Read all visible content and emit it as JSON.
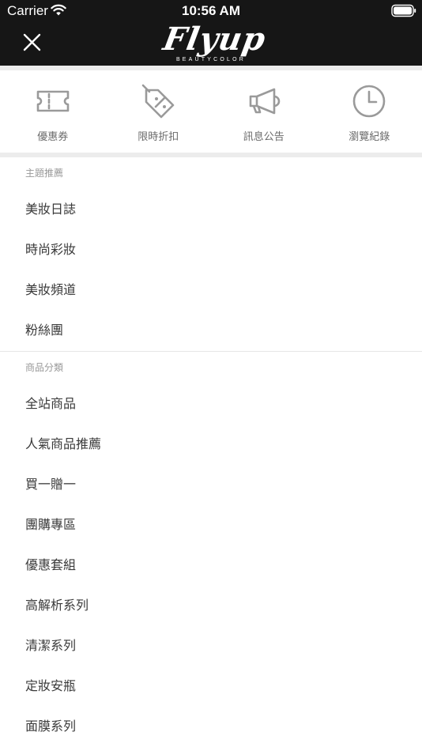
{
  "status_bar": {
    "carrier": "Carrier",
    "time": "10:56 AM"
  },
  "header": {
    "brand_name": "Flyup",
    "brand_sub": "BEAUTYCOLOR",
    "close_icon": "close-icon"
  },
  "quick_actions": [
    {
      "label": "優惠券",
      "icon": "ticket-icon"
    },
    {
      "label": "限時折扣",
      "icon": "discount-tag-icon"
    },
    {
      "label": "訊息公告",
      "icon": "megaphone-icon"
    },
    {
      "label": "瀏覽紀錄",
      "icon": "clock-icon"
    }
  ],
  "sections": [
    {
      "title": "主題推薦",
      "items": [
        "美妝日誌",
        "時尚彩妝",
        "美妝頻道",
        "粉絲團"
      ]
    },
    {
      "title": "商品分類",
      "items": [
        "全站商品",
        "人氣商品推薦",
        "買一贈一",
        "團購專區",
        "優惠套組",
        "高解析系列",
        "清潔系列",
        "定妝安瓶",
        "面膜系列"
      ]
    }
  ],
  "colors": {
    "header_bg": "#161616",
    "separator": "#ececec",
    "icon_gray": "#9a9a9a",
    "section_title": "#999999",
    "item_text": "#3a3a3a"
  }
}
